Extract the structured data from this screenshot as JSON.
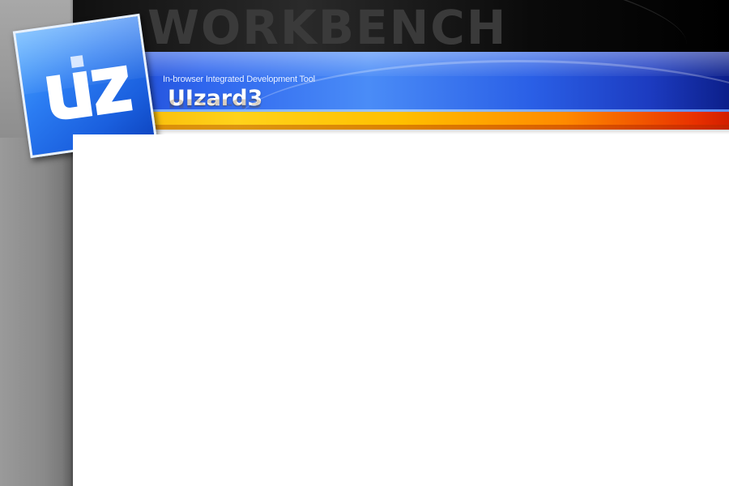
{
  "header": {
    "watermark": "WORKBENCH",
    "tagline": "In-browser Integrated Development Tool",
    "product_name": "UIzard3"
  },
  "logo": {
    "text": "uiz",
    "icon": "uiz-logo-icon"
  },
  "colors": {
    "banner_blue": "#2f66ee",
    "stripe_orange": "#ffbf00",
    "stripe_red": "#d21e00",
    "top_band": "#101010",
    "gutter_gray": "#8a8a8a"
  }
}
